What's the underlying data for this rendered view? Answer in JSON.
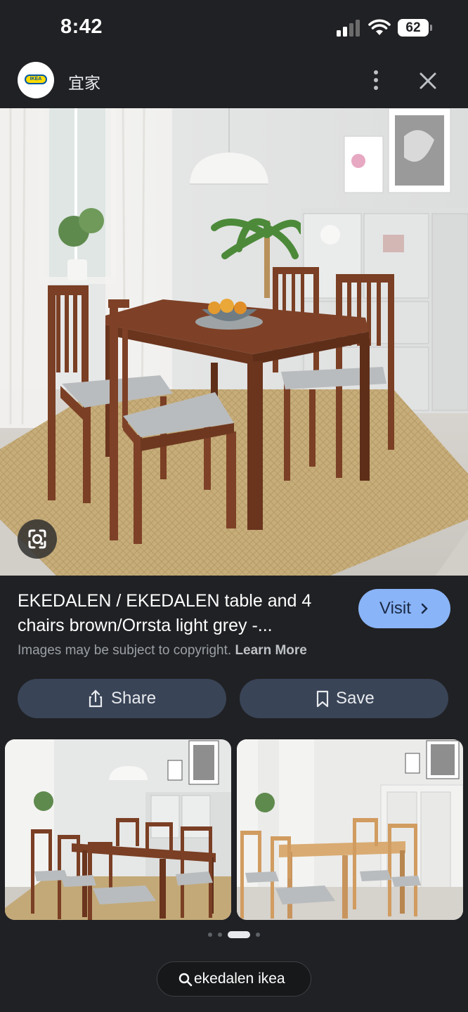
{
  "status_bar": {
    "time": "8:42",
    "battery": "62"
  },
  "header": {
    "site_name": "宜家",
    "logo_text": "IKEA"
  },
  "result": {
    "title": "EKEDALEN / EKEDALEN table and 4 chairs brown/Orrsta light grey -...",
    "visit_label": "Visit",
    "copyright_text": "Images may be subject to copyright.",
    "learn_more": "Learn More"
  },
  "actions": {
    "share_label": "Share",
    "save_label": "Save"
  },
  "carousel": {
    "pages": 4,
    "active_page": 3
  },
  "search": {
    "query": "ekedalen ikea"
  },
  "icons": [
    "cellular-signal-icon",
    "wifi-icon",
    "battery-icon",
    "more-vert-icon",
    "close-icon",
    "google-lens-icon",
    "share-icon",
    "bookmark-icon",
    "chevron-right-icon",
    "search-icon"
  ],
  "colors": {
    "background": "#202124",
    "visit_button": "#8ab4f8",
    "action_button": "#394457",
    "table_brown": "#7a3f24",
    "chair_seat": "#b9bcbe"
  }
}
